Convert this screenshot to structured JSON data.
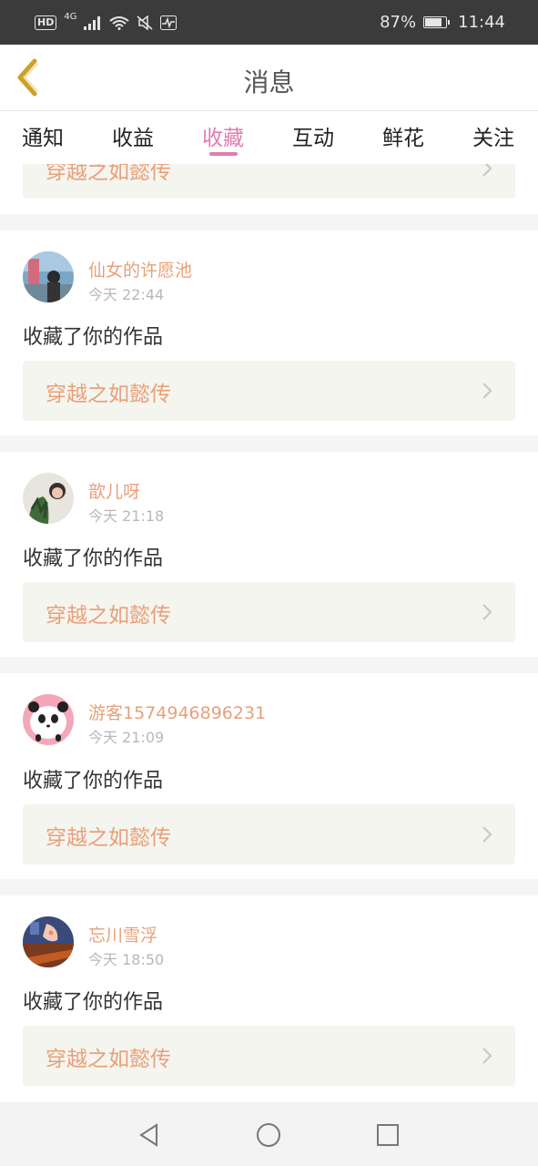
{
  "status_bar": {
    "hd": "HD",
    "network": "4G",
    "battery_percent": "87%",
    "battery_level": 0.87,
    "time": "11:44"
  },
  "header": {
    "title": "消息"
  },
  "tabs": [
    {
      "label": "通知"
    },
    {
      "label": "收益"
    },
    {
      "label": "收藏",
      "active": true
    },
    {
      "label": "互动"
    },
    {
      "label": "鲜花"
    },
    {
      "label": "关注"
    }
  ],
  "partial_card": {
    "work_title": "穿越之如懿传"
  },
  "notifications": [
    {
      "username": "仙女的许愿池",
      "time": "今天 22:44",
      "action": "收藏了你的作品",
      "work_title": "穿越之如懿传",
      "avatar_icon": "avatar-photo-icon"
    },
    {
      "username": "歆儿呀",
      "time": "今天 21:18",
      "action": "收藏了你的作品",
      "work_title": "穿越之如懿传",
      "avatar_icon": "avatar-photo-icon"
    },
    {
      "username": "游客1574946896231",
      "time": "今天 21:09",
      "action": "收藏了你的作品",
      "work_title": "穿越之如懿传",
      "avatar_icon": "panda-avatar-icon"
    },
    {
      "username": "忘川雪浮",
      "time": "今天 18:50",
      "action": "收藏了你的作品",
      "work_title": "穿越之如懿传",
      "avatar_icon": "avatar-photo-icon"
    }
  ],
  "colors": {
    "accent_pink": "#e07db0",
    "username_orange": "#e8a07a",
    "link_bg": "#f5f5ef",
    "back_arrow": "#c9a227"
  },
  "nav_bar": {
    "icons": [
      "back-triangle-icon",
      "home-circle-icon",
      "recents-square-icon"
    ]
  }
}
